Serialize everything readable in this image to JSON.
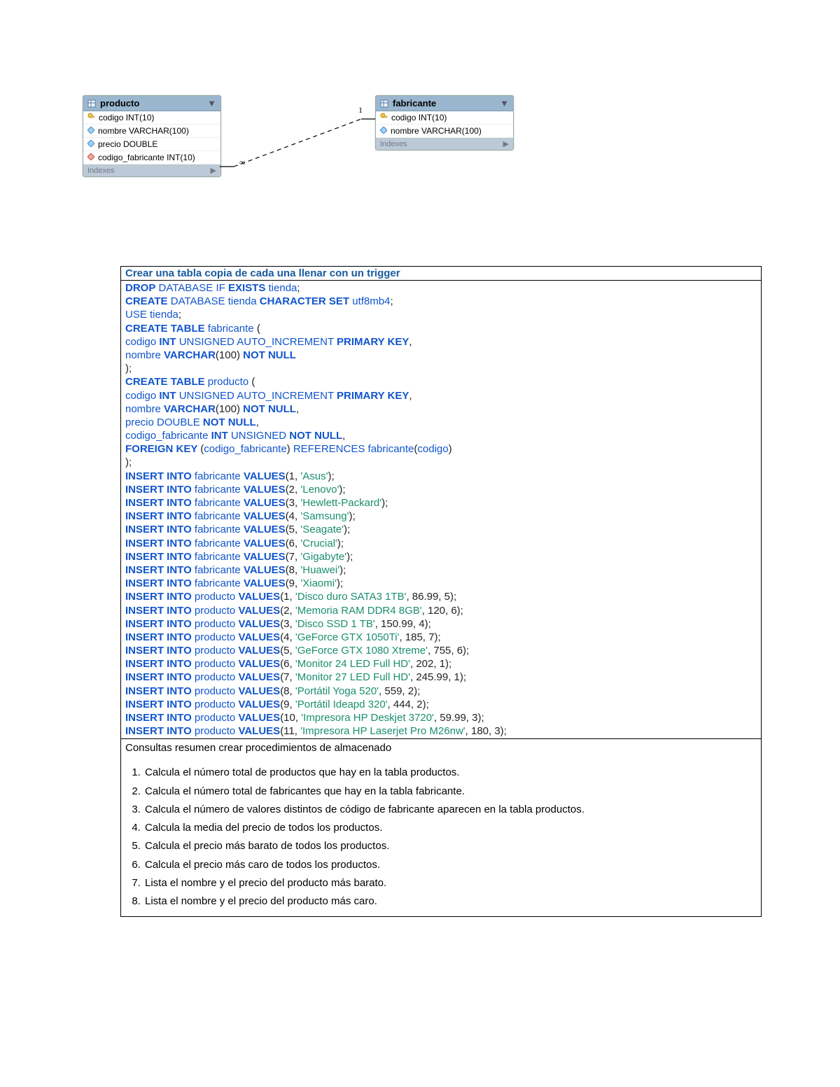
{
  "diagram": {
    "tables": {
      "producto": {
        "name": "producto",
        "cols": [
          {
            "icon": "key",
            "text": "codigo INT(10)"
          },
          {
            "icon": "dia-blue",
            "text": "nombre VARCHAR(100)"
          },
          {
            "icon": "dia-blue",
            "text": "precio DOUBLE"
          },
          {
            "icon": "dia-red",
            "text": "codigo_fabricante INT(10)"
          }
        ],
        "footer": "Indexes"
      },
      "fabricante": {
        "name": "fabricante",
        "cols": [
          {
            "icon": "key",
            "text": "codigo INT(10)"
          },
          {
            "icon": "dia-blue",
            "text": "nombre VARCHAR(100)"
          }
        ],
        "footer": "Indexes"
      }
    },
    "cardinality": {
      "left": "∞",
      "right": "1"
    }
  },
  "box_title": "Crear una tabla copia de cada una llenar con un trigger",
  "sql_lines": [
    [
      {
        "c": "kw",
        "t": "DROP"
      },
      {
        "c": "id",
        "t": " DATABASE IF "
      },
      {
        "c": "kw",
        "t": "EXISTS"
      },
      {
        "c": "id",
        "t": " tienda"
      },
      {
        "c": "plain",
        "t": ";"
      }
    ],
    [
      {
        "c": "kw",
        "t": "CREATE"
      },
      {
        "c": "id",
        "t": " DATABASE tienda "
      },
      {
        "c": "kw",
        "t": "CHARACTER SET"
      },
      {
        "c": "id",
        "t": " utf8mb4"
      },
      {
        "c": "plain",
        "t": ";"
      }
    ],
    [
      {
        "c": "id",
        "t": "USE tienda"
      },
      {
        "c": "plain",
        "t": ";"
      }
    ],
    [
      {
        "c": "kw",
        "t": "CREATE TABLE"
      },
      {
        "c": "id",
        "t": " fabricante "
      },
      {
        "c": "plain",
        "t": "("
      }
    ],
    [
      {
        "c": "id",
        "t": "codigo "
      },
      {
        "c": "kw",
        "t": "INT"
      },
      {
        "c": "id",
        "t": " UNSIGNED AUTO_INCREMENT "
      },
      {
        "c": "kw",
        "t": "PRIMARY KEY"
      },
      {
        "c": "plain",
        "t": ","
      }
    ],
    [
      {
        "c": "id",
        "t": "nombre "
      },
      {
        "c": "kw",
        "t": "VARCHAR"
      },
      {
        "c": "plain",
        "t": "(100) "
      },
      {
        "c": "kw",
        "t": "NOT NULL"
      }
    ],
    [
      {
        "c": "plain",
        "t": ");"
      }
    ],
    [
      {
        "c": "kw",
        "t": "CREATE TABLE"
      },
      {
        "c": "id",
        "t": " producto "
      },
      {
        "c": "plain",
        "t": "("
      }
    ],
    [
      {
        "c": "id",
        "t": "codigo "
      },
      {
        "c": "kw",
        "t": "INT"
      },
      {
        "c": "id",
        "t": " UNSIGNED AUTO_INCREMENT "
      },
      {
        "c": "kw",
        "t": "PRIMARY KEY"
      },
      {
        "c": "plain",
        "t": ","
      }
    ],
    [
      {
        "c": "id",
        "t": "nombre "
      },
      {
        "c": "kw",
        "t": "VARCHAR"
      },
      {
        "c": "plain",
        "t": "(100) "
      },
      {
        "c": "kw",
        "t": "NOT NULL"
      },
      {
        "c": "plain",
        "t": ","
      }
    ],
    [
      {
        "c": "id",
        "t": "precio DOUBLE "
      },
      {
        "c": "kw",
        "t": "NOT NULL"
      },
      {
        "c": "plain",
        "t": ","
      }
    ],
    [
      {
        "c": "id",
        "t": "codigo_fabricante "
      },
      {
        "c": "kw",
        "t": "INT"
      },
      {
        "c": "id",
        "t": " UNSIGNED "
      },
      {
        "c": "kw",
        "t": "NOT NULL"
      },
      {
        "c": "plain",
        "t": ","
      }
    ],
    [
      {
        "c": "kw",
        "t": "FOREIGN KEY "
      },
      {
        "c": "plain",
        "t": "("
      },
      {
        "c": "id",
        "t": "codigo_fabricante"
      },
      {
        "c": "plain",
        "t": ") "
      },
      {
        "c": "id",
        "t": "REFERENCES fabricante"
      },
      {
        "c": "plain",
        "t": "("
      },
      {
        "c": "id",
        "t": "codigo"
      },
      {
        "c": "plain",
        "t": ")"
      }
    ],
    [
      {
        "c": "plain",
        "t": ");"
      }
    ],
    [
      {
        "c": "kw",
        "t": "INSERT INTO"
      },
      {
        "c": "id",
        "t": " fabricante "
      },
      {
        "c": "kw",
        "t": "VALUES"
      },
      {
        "c": "plain",
        "t": "(1, "
      },
      {
        "c": "str",
        "t": "'Asus'"
      },
      {
        "c": "plain",
        "t": ");"
      }
    ],
    [
      {
        "c": "kw",
        "t": "INSERT INTO"
      },
      {
        "c": "id",
        "t": " fabricante "
      },
      {
        "c": "kw",
        "t": "VALUES"
      },
      {
        "c": "plain",
        "t": "(2, "
      },
      {
        "c": "str",
        "t": "'Lenovo'"
      },
      {
        "c": "plain",
        "t": ");"
      }
    ],
    [
      {
        "c": "kw",
        "t": "INSERT INTO"
      },
      {
        "c": "id",
        "t": " fabricante "
      },
      {
        "c": "kw",
        "t": "VALUES"
      },
      {
        "c": "plain",
        "t": "(3, "
      },
      {
        "c": "str",
        "t": "'Hewlett-Packard'"
      },
      {
        "c": "plain",
        "t": ");"
      }
    ],
    [
      {
        "c": "kw",
        "t": "INSERT INTO"
      },
      {
        "c": "id",
        "t": " fabricante "
      },
      {
        "c": "kw",
        "t": "VALUES"
      },
      {
        "c": "plain",
        "t": "(4, "
      },
      {
        "c": "str",
        "t": "'Samsung'"
      },
      {
        "c": "plain",
        "t": ");"
      }
    ],
    [
      {
        "c": "kw",
        "t": "INSERT INTO"
      },
      {
        "c": "id",
        "t": " fabricante "
      },
      {
        "c": "kw",
        "t": "VALUES"
      },
      {
        "c": "plain",
        "t": "(5, "
      },
      {
        "c": "str",
        "t": "'Seagate'"
      },
      {
        "c": "plain",
        "t": ");"
      }
    ],
    [
      {
        "c": "kw",
        "t": "INSERT INTO"
      },
      {
        "c": "id",
        "t": " fabricante "
      },
      {
        "c": "kw",
        "t": "VALUES"
      },
      {
        "c": "plain",
        "t": "(6, "
      },
      {
        "c": "str",
        "t": "'Crucial'"
      },
      {
        "c": "plain",
        "t": ");"
      }
    ],
    [
      {
        "c": "kw",
        "t": "INSERT INTO"
      },
      {
        "c": "id",
        "t": " fabricante "
      },
      {
        "c": "kw",
        "t": "VALUES"
      },
      {
        "c": "plain",
        "t": "(7, "
      },
      {
        "c": "str",
        "t": "'Gigabyte'"
      },
      {
        "c": "plain",
        "t": ");"
      }
    ],
    [
      {
        "c": "kw",
        "t": "INSERT INTO"
      },
      {
        "c": "id",
        "t": " fabricante "
      },
      {
        "c": "kw",
        "t": "VALUES"
      },
      {
        "c": "plain",
        "t": "(8, "
      },
      {
        "c": "str",
        "t": "'Huawei'"
      },
      {
        "c": "plain",
        "t": ");"
      }
    ],
    [
      {
        "c": "kw",
        "t": "INSERT INTO"
      },
      {
        "c": "id",
        "t": " fabricante "
      },
      {
        "c": "kw",
        "t": "VALUES"
      },
      {
        "c": "plain",
        "t": "(9, "
      },
      {
        "c": "str",
        "t": "'Xiaomi'"
      },
      {
        "c": "plain",
        "t": ");"
      }
    ],
    [
      {
        "c": "kw",
        "t": "INSERT INTO"
      },
      {
        "c": "id",
        "t": " producto "
      },
      {
        "c": "kw",
        "t": "VALUES"
      },
      {
        "c": "plain",
        "t": "(1, "
      },
      {
        "c": "str",
        "t": "'Disco duro SATA3 1TB'"
      },
      {
        "c": "plain",
        "t": ", 86.99, 5);"
      }
    ],
    [
      {
        "c": "kw",
        "t": "INSERT INTO"
      },
      {
        "c": "id",
        "t": " producto "
      },
      {
        "c": "kw",
        "t": "VALUES"
      },
      {
        "c": "plain",
        "t": "(2, "
      },
      {
        "c": "str",
        "t": "'Memoria RAM DDR4 8GB'"
      },
      {
        "c": "plain",
        "t": ", 120, 6);"
      }
    ],
    [
      {
        "c": "kw",
        "t": "INSERT INTO"
      },
      {
        "c": "id",
        "t": " producto "
      },
      {
        "c": "kw",
        "t": "VALUES"
      },
      {
        "c": "plain",
        "t": "(3, "
      },
      {
        "c": "str",
        "t": "'Disco SSD 1 TB'"
      },
      {
        "c": "plain",
        "t": ", 150.99, 4);"
      }
    ],
    [
      {
        "c": "kw",
        "t": "INSERT INTO"
      },
      {
        "c": "id",
        "t": " producto "
      },
      {
        "c": "kw",
        "t": "VALUES"
      },
      {
        "c": "plain",
        "t": "(4, "
      },
      {
        "c": "str",
        "t": "'GeForce GTX 1050Ti'"
      },
      {
        "c": "plain",
        "t": ", 185, 7);"
      }
    ],
    [
      {
        "c": "kw",
        "t": "INSERT INTO"
      },
      {
        "c": "id",
        "t": " producto "
      },
      {
        "c": "kw",
        "t": "VALUES"
      },
      {
        "c": "plain",
        "t": "(5, "
      },
      {
        "c": "str",
        "t": "'GeForce GTX 1080 Xtreme'"
      },
      {
        "c": "plain",
        "t": ", 755, 6);"
      }
    ],
    [
      {
        "c": "kw",
        "t": "INSERT INTO"
      },
      {
        "c": "id",
        "t": " producto "
      },
      {
        "c": "kw",
        "t": "VALUES"
      },
      {
        "c": "plain",
        "t": "(6, "
      },
      {
        "c": "str",
        "t": "'Monitor 24 LED Full HD'"
      },
      {
        "c": "plain",
        "t": ", 202, 1);"
      }
    ],
    [
      {
        "c": "kw",
        "t": "INSERT INTO"
      },
      {
        "c": "id",
        "t": " producto "
      },
      {
        "c": "kw",
        "t": "VALUES"
      },
      {
        "c": "plain",
        "t": "(7, "
      },
      {
        "c": "str",
        "t": "'Monitor 27 LED Full HD'"
      },
      {
        "c": "plain",
        "t": ", 245.99, 1);"
      }
    ],
    [
      {
        "c": "kw",
        "t": "INSERT INTO"
      },
      {
        "c": "id",
        "t": " producto "
      },
      {
        "c": "kw",
        "t": "VALUES"
      },
      {
        "c": "plain",
        "t": "(8, "
      },
      {
        "c": "str",
        "t": "'Portátil Yoga 520'"
      },
      {
        "c": "plain",
        "t": ", 559, 2);"
      }
    ],
    [
      {
        "c": "kw",
        "t": "INSERT INTO"
      },
      {
        "c": "id",
        "t": " producto "
      },
      {
        "c": "kw",
        "t": "VALUES"
      },
      {
        "c": "plain",
        "t": "(9, "
      },
      {
        "c": "str",
        "t": "'Portátil Ideapd 320'"
      },
      {
        "c": "plain",
        "t": ", 444, 2);"
      }
    ],
    [
      {
        "c": "kw",
        "t": "INSERT INTO"
      },
      {
        "c": "id",
        "t": " producto "
      },
      {
        "c": "kw",
        "t": "VALUES"
      },
      {
        "c": "plain",
        "t": "(10, "
      },
      {
        "c": "str",
        "t": "'Impresora HP Deskjet 3720'"
      },
      {
        "c": "plain",
        "t": ", 59.99, 3);"
      }
    ],
    [
      {
        "c": "kw",
        "t": "INSERT INTO"
      },
      {
        "c": "id",
        "t": " producto "
      },
      {
        "c": "kw",
        "t": "VALUES"
      },
      {
        "c": "plain",
        "t": "(11, "
      },
      {
        "c": "str",
        "t": "'Impresora HP Laserjet Pro M26nw'"
      },
      {
        "c": "plain",
        "t": ", 180, 3);"
      }
    ]
  ],
  "tasks_header": "Consultas resumen crear procedimientos de almacenado",
  "tasks": [
    "Calcula el número total de productos que hay en la tabla productos.",
    "Calcula el número total de fabricantes que hay en la tabla fabricante.",
    "Calcula el número de valores distintos de código de fabricante aparecen en la tabla productos.",
    "Calcula la media del precio de todos los productos.",
    "Calcula el precio más barato de todos los productos.",
    "Calcula el precio más caro de todos los productos.",
    "Lista el nombre y el precio del producto más barato.",
    "Lista el nombre y el precio del producto más caro."
  ]
}
